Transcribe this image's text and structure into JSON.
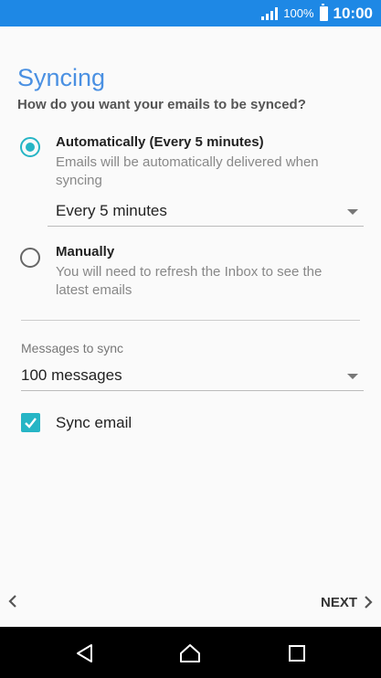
{
  "status_bar": {
    "battery_percent": "100%",
    "time": "10:00",
    "signal_icon": "signal-icon",
    "battery_icon": "battery-icon"
  },
  "page": {
    "title": "Syncing",
    "subtitle": "How do you want your emails to be synced?"
  },
  "options": [
    {
      "title": "Automatically (Every 5 minutes)",
      "description": "Emails will be automatically delivered when syncing",
      "selected": true
    },
    {
      "title": "Manually",
      "description": "You will need to refresh the Inbox to see the latest emails",
      "selected": false
    }
  ],
  "sync_frequency": {
    "value": "Every 5 minutes"
  },
  "messages_to_sync": {
    "label": "Messages to sync",
    "value": "100 messages"
  },
  "sync_email": {
    "label": "Sync email",
    "checked": true
  },
  "footer": {
    "next_label": "NEXT"
  },
  "colors": {
    "accent": "#26b5c5",
    "status_bar": "#1e88e5",
    "title": "#4a90e2"
  }
}
